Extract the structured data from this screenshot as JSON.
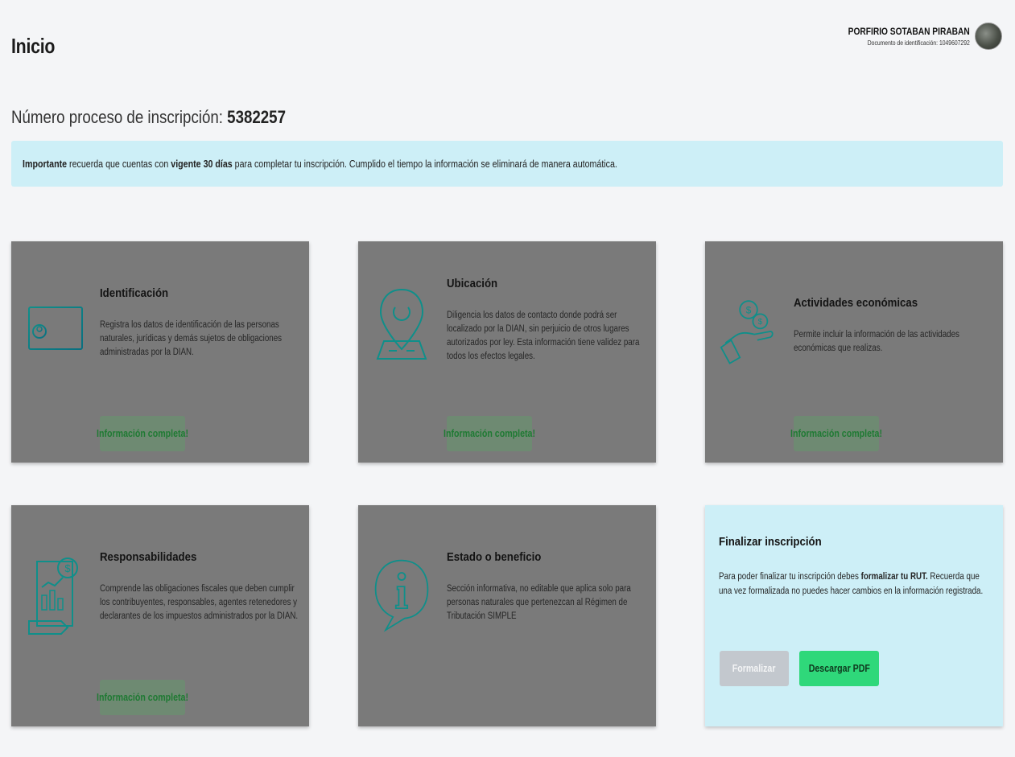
{
  "header": {
    "title": "Inicio",
    "user_name": "PORFIRIO SOTABAN PIRABAN",
    "user_doc": "Documento de identificación: 1049607292"
  },
  "process": {
    "label": "Número proceso de inscripción:",
    "number": "5382257"
  },
  "notice": {
    "strong1": "Importante",
    "text1": " recuerda que cuentas con ",
    "strong2": "vigente 30 días",
    "text2": " para completar tu inscripción. Cumplido el tiempo la información se eliminará de manera automática."
  },
  "cards": [
    {
      "title": "Identificación",
      "description": "Registra los datos de identificación de las personas naturales, jurídicas y demás sujetos de obligaciones administradas por la DIAN.",
      "status": "Información completa!",
      "icon": "id-card-icon"
    },
    {
      "title": "Ubicación",
      "description": "Diligencia los datos de contacto donde podrá ser localizado por la DIAN, sin perjuicio de otros lugares autorizados por ley. Esta información tiene validez para todos los efectos legales.",
      "status": "Información completa!",
      "icon": "location-pin-icon"
    },
    {
      "title": "Actividades económicas",
      "description": "Permite incluir la información de las actividades económicas que realizas.",
      "status": "Información completa!",
      "icon": "hand-coins-icon"
    },
    {
      "title": "Responsabilidades",
      "description": "Comprende las obligaciones fiscales que deben cumplir los contribuyentes, responsables, agentes retenedores y declarantes de los impuestos administrados por la DIAN.",
      "status": "Información completa!",
      "icon": "tax-document-icon"
    },
    {
      "title": "Estado o beneficio",
      "description": "Sección informativa, no editable que aplica solo para personas naturales que pertenezcan al Régimen de Tributación SIMPLE",
      "icon": "info-bubble-icon"
    }
  ],
  "final": {
    "title": "Finalizar inscripción",
    "desc_before": "Para poder finalizar tu inscripción debes ",
    "desc_strong": "formalizar tu RUT.",
    "desc_after": " Recuerda que una vez formalizada no puedes hacer cambios en la información registrada.",
    "btn_formalizar": "Formalizar",
    "btn_pdf": "Descargar PDF"
  },
  "colors": {
    "card_bg": "#7a7a7a",
    "icon_teal": "#0f8f8a",
    "badge_text": "#1f7a33",
    "notice_bg": "#cdeff7",
    "pdf_button": "#2fd87a"
  }
}
